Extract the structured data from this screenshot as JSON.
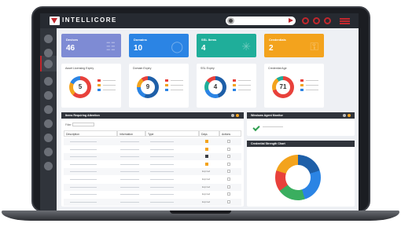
{
  "app": {
    "brand": "INTELLICORE"
  },
  "stats": [
    {
      "label": "Devices",
      "value": "46",
      "color": "#7e8bd4",
      "icon": "devices-icon"
    },
    {
      "label": "Domains",
      "value": "10",
      "color": "#2b84e4",
      "icon": "globe-icon"
    },
    {
      "label": "SSL Items",
      "value": "4",
      "color": "#1fae9a",
      "icon": "certificate-icon"
    },
    {
      "label": "Credentials",
      "value": "2",
      "color": "#f3a31d",
      "icon": "key-icon"
    }
  ],
  "donut_cards": [
    {
      "title": "Asset Licensing Expiry",
      "value": "5"
    },
    {
      "title": "Domain Expiry",
      "value": "9"
    },
    {
      "title": "SSL Expiry",
      "value": "4"
    },
    {
      "title": "Credential Age",
      "value": "71"
    }
  ],
  "table_panel": {
    "title": "Items Requiring Attention",
    "filter_label": "Filter:",
    "columns": [
      "Description",
      "Information",
      "Type",
      "Days",
      "Actions"
    ],
    "row_days": [
      "",
      "",
      "",
      "",
      "Expired",
      "Expired",
      "Expired",
      "Expired",
      "Expired"
    ]
  },
  "monitor_panel": {
    "title": "Windows Agent Monitor"
  },
  "strength_panel": {
    "title": "Credential Strength Chart"
  },
  "colors": {
    "red": "#e8413b",
    "blue": "#2b84e4",
    "orange": "#f3a31d",
    "green": "#3aae5f",
    "teal": "#1fae9a",
    "navy": "#1e5fa8",
    "dark": "#30343b",
    "accent": "#c1272d"
  }
}
